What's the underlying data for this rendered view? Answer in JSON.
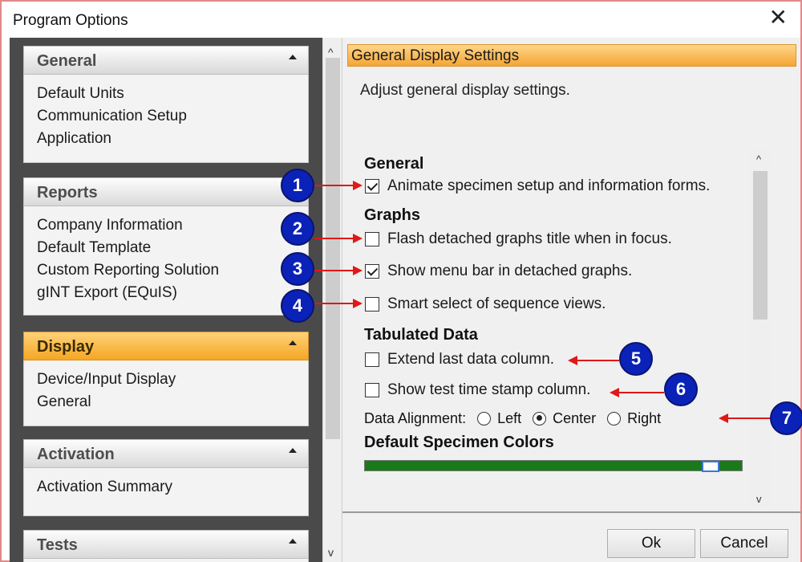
{
  "window": {
    "title": "Program Options"
  },
  "sidebar": {
    "groups": [
      {
        "label": "General",
        "items": [
          "Default Units",
          "Communication Setup",
          "Application"
        ]
      },
      {
        "label": "Reports",
        "items": [
          "Company Information",
          "Default Template",
          "Custom Reporting Solution",
          "gINT Export (EQuIS)"
        ]
      },
      {
        "label": "Display",
        "items": [
          "Device/Input Display",
          "General"
        ]
      },
      {
        "label": "Activation",
        "items": [
          "Activation Summary"
        ]
      },
      {
        "label": "Tests",
        "items": []
      }
    ],
    "active_group": "Display"
  },
  "main": {
    "section_title": "General Display Settings",
    "description": "Adjust general display settings.",
    "general_heading": "General",
    "animate_label": "Animate specimen setup and information forms.",
    "animate_checked": true,
    "graphs_heading": "Graphs",
    "flash_label": "Flash detached graphs title when in focus.",
    "flash_checked": false,
    "menubar_label": "Show menu bar in detached graphs.",
    "menubar_checked": true,
    "smartselect_label": "Smart select of sequence views.",
    "smartselect_checked": false,
    "tabulated_heading": "Tabulated Data",
    "extend_label": "Extend last data column.",
    "extend_checked": false,
    "timestamp_label": "Show test time stamp column.",
    "timestamp_checked": false,
    "alignment_label": "Data Alignment:",
    "alignment_options": [
      "Left",
      "Center",
      "Right"
    ],
    "alignment_selected": "Center",
    "colors_heading": "Default Specimen Colors"
  },
  "buttons": {
    "ok": "Ok",
    "cancel": "Cancel"
  },
  "annotations": [
    "1",
    "2",
    "3",
    "4",
    "5",
    "6",
    "7"
  ],
  "colors": {
    "accent_header": "#f4a534",
    "annotation_badge": "#0a22b8",
    "annotation_arrow": "#e01818",
    "specimen_color": "#1a7a1a"
  },
  "icons": {
    "close": "close-icon",
    "scroll_up": "chevron-up-icon",
    "scroll_down": "chevron-down-icon",
    "collapse": "triangle-up-icon"
  }
}
